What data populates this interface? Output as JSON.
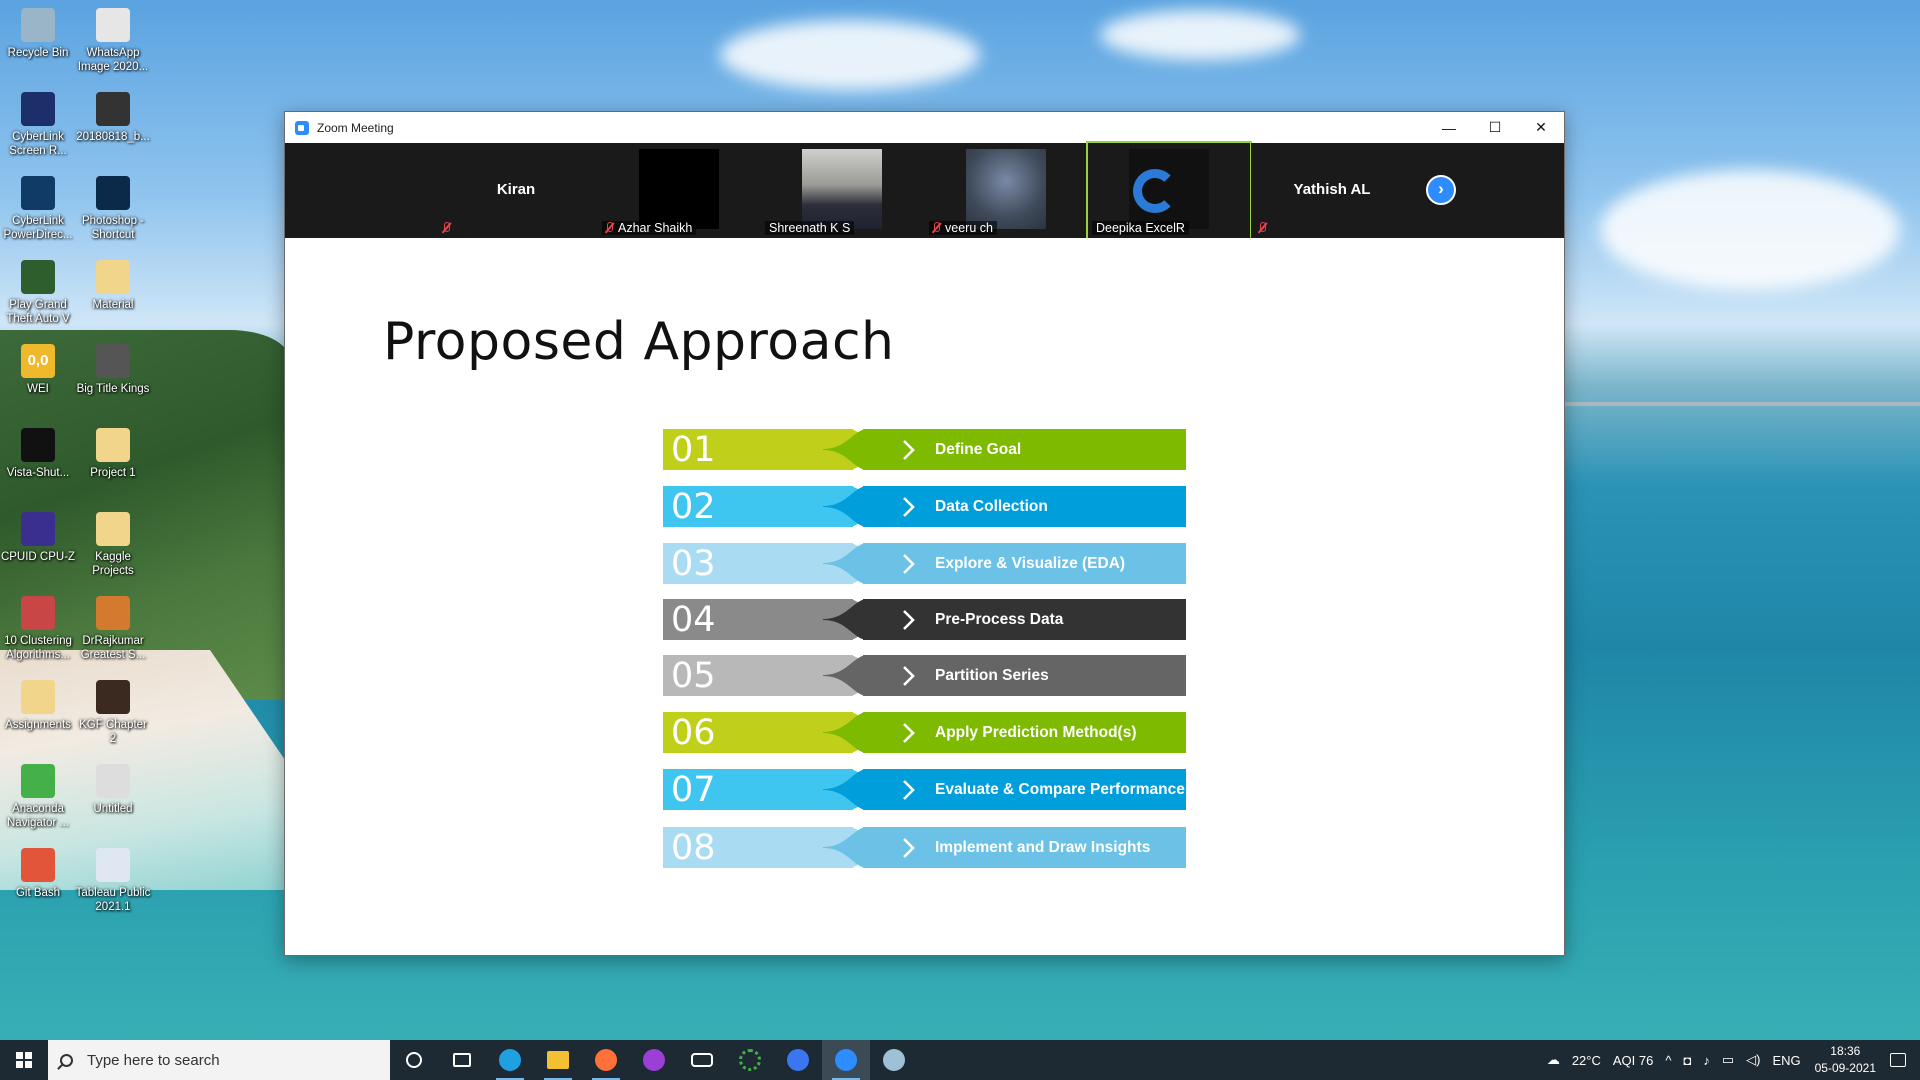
{
  "desktop": {
    "icons": [
      {
        "label": "Recycle Bin",
        "color": "#9ab4c8"
      },
      {
        "label": "WhatsApp Image 2020...",
        "color": "#e6e6e6"
      },
      {
        "label": "CyberLink Screen R...",
        "color": "#1d2f6b"
      },
      {
        "label": "20180818_b...",
        "color": "#333333"
      },
      {
        "label": "CyberLink PowerDirec...",
        "color": "#0f3b66"
      },
      {
        "label": "Photoshop - Shortcut",
        "color": "#0b2a4a"
      },
      {
        "label": "Play Grand Theft Auto V",
        "color": "#2e5d2e"
      },
      {
        "label": "Material",
        "color": "#f0d58a"
      },
      {
        "label": "WEI",
        "color": "#f0b92b"
      },
      {
        "label": "Big Title Kings",
        "color": "#555555"
      },
      {
        "label": "Vista-Shut...",
        "color": "#111111"
      },
      {
        "label": "Project 1",
        "color": "#f0d58a"
      },
      {
        "label": "CPUID CPU-Z",
        "color": "#3a2f8f"
      },
      {
        "label": "Kaggle Projects",
        "color": "#f0d58a"
      },
      {
        "label": "10 Clustering Algorithms...",
        "color": "#c94646"
      },
      {
        "label": "DrRajkumar Greatest S...",
        "color": "#d47a2e"
      },
      {
        "label": "Assignments",
        "color": "#f0d58a"
      },
      {
        "label": "KGF Chapter 2",
        "color": "#3a2a20"
      },
      {
        "label": "Anaconda Navigator ...",
        "color": "#43b049"
      },
      {
        "label": "Untitled",
        "color": "#dddddd"
      },
      {
        "label": "Git Bash",
        "color": "#e2553a"
      },
      {
        "label": "Tableau Public 2021.1",
        "color": "#dfe8f2"
      }
    ],
    "wei_badge": "0,0"
  },
  "window": {
    "title": "Zoom Meeting",
    "minimize": "—",
    "maximize": "☐",
    "close": "✕"
  },
  "participants": [
    {
      "name": "Kiran",
      "display": "name",
      "muted": true
    },
    {
      "name": "Azhar Shaikh",
      "display": "video",
      "muted": true,
      "video_color": "#000000"
    },
    {
      "name": "Shreenath K S",
      "display": "video",
      "muted": false,
      "video_color": "#8c8c88"
    },
    {
      "name": "veeru ch",
      "display": "video",
      "muted": true,
      "video_color": "#3f4a5a"
    },
    {
      "name": "Deepika ExcelR",
      "display": "video",
      "muted": false,
      "video_color": "#0f0f0f"
    },
    {
      "name": "Yathish AL",
      "display": "name",
      "muted": true
    }
  ],
  "next_button": "›",
  "slide": {
    "title": "Proposed Approach",
    "steps": [
      {
        "num": "01",
        "label": "Define Goal",
        "num_color": "#bfcf1a",
        "label_color": "#7dba00"
      },
      {
        "num": "02",
        "label": "Data Collection",
        "num_color": "#3fc6f0",
        "label_color": "#009fdc"
      },
      {
        "num": "03",
        "label": "Explore & Visualize (EDA)",
        "num_color": "#a9dcf2",
        "label_color": "#6cc2e6"
      },
      {
        "num": "04",
        "label": "Pre-Process Data",
        "num_color": "#8a8a8a",
        "label_color": "#333333"
      },
      {
        "num": "05",
        "label": "Partition Series",
        "num_color": "#b8b8b8",
        "label_color": "#656565"
      },
      {
        "num": "06",
        "label": "Apply Prediction Method(s)",
        "num_color": "#bfcf1a",
        "label_color": "#7dba00"
      },
      {
        "num": "07",
        "label": "Evaluate & Compare Performance",
        "num_color": "#3fc6f0",
        "label_color": "#009fdc"
      },
      {
        "num": "08",
        "label": "Implement and Draw Insights",
        "num_color": "#a9dcf2",
        "label_color": "#6cc2e6"
      }
    ]
  },
  "taskbar": {
    "search_placeholder": "Type here to search",
    "apps": [
      {
        "name": "cortana",
        "color": "#ffffff"
      },
      {
        "name": "task-view",
        "color": "#ffffff"
      },
      {
        "name": "edge",
        "color": "#1fa0e0"
      },
      {
        "name": "file-explorer",
        "color": "#f3c033"
      },
      {
        "name": "firefox",
        "color": "#ff7139"
      },
      {
        "name": "podcasts",
        "color": "#9b3fd6"
      },
      {
        "name": "prime-video",
        "color": "#ffffff"
      },
      {
        "name": "circle-app",
        "color": "#43b049"
      },
      {
        "name": "signal",
        "color": "#3a76f0"
      },
      {
        "name": "zoom",
        "color": "#2d8cff"
      },
      {
        "name": "paint",
        "color": "#9fc1d8"
      }
    ],
    "weather": "22°C",
    "aqi": "AQI 76",
    "language": "ENG",
    "time": "18:36",
    "date": "05-09-2021"
  }
}
